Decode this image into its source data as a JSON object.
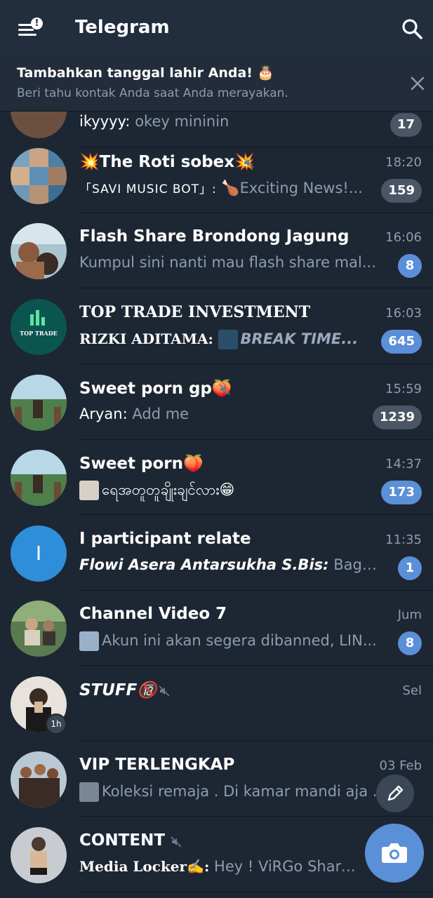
{
  "app": {
    "title": "Telegram"
  },
  "banner": {
    "title": "Tambahkan tanggal lahir Anda! 🎂",
    "subtitle": "Beri tahu kontak Anda saat Anda merayakan."
  },
  "colors": {
    "header": "#222e3e",
    "background": "#1d2733",
    "accent": "#5b8fd8",
    "muted_badge": "#4a5565",
    "secondary_text": "#8d9caf"
  },
  "chats": [
    {
      "name": "",
      "preview_sender": "ikyyyy:",
      "preview_text": " okey mininin",
      "time": "",
      "badge": "17"
    },
    {
      "name": "💥The Roti sobex💥",
      "muted": true,
      "time": "18:20",
      "preview_sender": "「SAVI MUSIC BOT」:",
      "preview_text": " 🍗Exciting News!...",
      "badge": "159"
    },
    {
      "name": "Flash Share Brondong Jagung",
      "time": "16:06",
      "preview_text": "Kumpul sini nanti mau flash share mal...",
      "badge": "8"
    },
    {
      "name": "TOP TRADE INVESTMENT",
      "time": "16:03",
      "preview_sender": "RIZKI ADITAMA:",
      "preview_text": "BREAK TIME...",
      "badge": "645",
      "avatar_text": "TOP TRADE"
    },
    {
      "name": "Sweet porn gp🍑",
      "muted": true,
      "time": "15:59",
      "preview_sender": "Aryan:",
      "preview_text": " Add me",
      "badge": "1239"
    },
    {
      "name": "Sweet porn🍑",
      "time": "14:37",
      "preview_text": "ရေအတူတူချိုးချင်လား😁",
      "badge": "173"
    },
    {
      "name": "I participant relate",
      "time": "11:35",
      "preview_sender": "Flowi Asera Antarsukha S.Bis:",
      "preview_text": " Bagi y...",
      "badge": "1",
      "avatar_letter": "I"
    },
    {
      "name": "Channel Video 7",
      "time": "Jum",
      "preview_text": "Akun ini akan segera dibanned, LIN...",
      "badge": "8"
    },
    {
      "name": "STUFF🔞",
      "muted": true,
      "time": "Sel",
      "preview_text": "",
      "story_badge": "1h"
    },
    {
      "name": "VIP TERLENGKAP",
      "time": "03 Feb",
      "preview_text": "Koleksi remaja .  Di kamar mandi aja ."
    },
    {
      "name": "CONTENT",
      "muted": true,
      "time": "",
      "preview_sender": "Media Locker✍️:",
      "preview_text": " Hey ! ViRGo  Share..."
    }
  ],
  "icons": {
    "menu": "menu-icon",
    "search": "search-icon",
    "close": "close-icon",
    "mute": "mute-icon",
    "edit": "pencil-icon",
    "camera": "camera-icon"
  }
}
